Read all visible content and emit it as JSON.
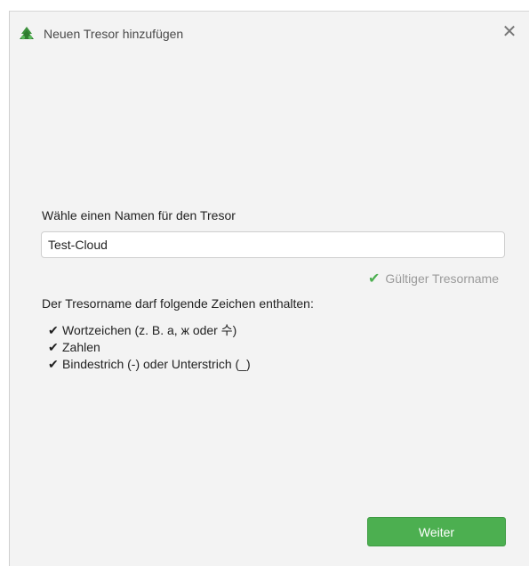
{
  "window": {
    "title": "Neuen Tresor hinzufügen",
    "close_glyph": "✕"
  },
  "form": {
    "name_label": "Wähle einen Namen für den Tresor",
    "name_value": "Test-Cloud",
    "valid_text": "Gültiger Tresorname",
    "rules_title": "Der Tresorname darf folgende Zeichen enthalten:",
    "rules": [
      "Wortzeichen (z. B. a, ж oder 수)",
      "Zahlen",
      "Bindestrich (-) oder Unterstrich (_)"
    ]
  },
  "footer": {
    "next_label": "Weiter"
  },
  "colors": {
    "accent": "#4caf50",
    "window_bg": "#f3f3f3"
  }
}
